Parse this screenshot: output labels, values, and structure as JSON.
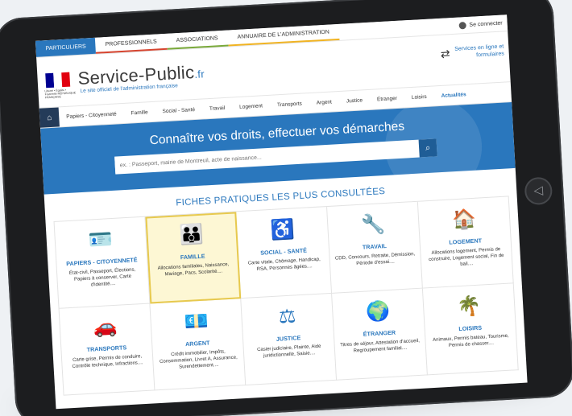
{
  "topnav": {
    "tabs": [
      "Particuliers",
      "Professionnels",
      "Associations",
      "Annuaire de l'administration"
    ],
    "connect": "Se connecter"
  },
  "brand": {
    "name": "Service-Public",
    "suffix": ".fr",
    "tagline": "Le site officiel de l'administration française",
    "logo_text": "Liberté • Égalité • Fraternité RÉPUBLIQUE FRANÇAISE",
    "services": "Services en ligne et formulaires"
  },
  "colors": {
    "flag_blue": "#000091",
    "flag_white": "#ffffff",
    "flag_red": "#e1000f",
    "accent": "#2a77bd"
  },
  "categories": [
    "Papiers - Citoyenneté",
    "Famille",
    "Social - Santé",
    "Travail",
    "Logement",
    "Transports",
    "Argent",
    "Justice",
    "Étranger",
    "Loisirs",
    "Actualités"
  ],
  "hero": {
    "title": "Connaître vos droits, effectuer vos démarches",
    "placeholder": "ex. : Passeport, mairie de Montreuil, acte de naissance..."
  },
  "section_title": "FICHES PRATIQUES LES PLUS CONSULTÉES",
  "cards": [
    {
      "title": "Papiers - Citoyenneté",
      "desc": "État-civil, Passeport, Élections, Papiers à conserver, Carte d'identité....",
      "icon": "id-card-icon"
    },
    {
      "title": "Famille",
      "desc": "Allocations familiales, Naissance, Mariage, Pacs, Scolarité....",
      "icon": "family-icon"
    },
    {
      "title": "Social - Santé",
      "desc": "Carte vitale, Chômage, Handicap, RSA, Personnes âgées....",
      "icon": "people-wheelchair-icon"
    },
    {
      "title": "Travail",
      "desc": "CDD, Concours, Retraite, Démission, Période d'essai....",
      "icon": "tools-icon"
    },
    {
      "title": "Logement",
      "desc": "Allocations logement, Permis de construire, Logement social, Fin de bail....",
      "icon": "house-icon"
    },
    {
      "title": "Transports",
      "desc": "Carte grise, Permis de conduire, Contrôle technique, Infractions....",
      "icon": "car-icon"
    },
    {
      "title": "Argent",
      "desc": "Crédit immobilier, Impôts, Consommation, Livret A, Assurance, Surendettement....",
      "icon": "money-icon"
    },
    {
      "title": "Justice",
      "desc": "Casier judiciaire, Plainte, Aide juridictionnelle, Saisie....",
      "icon": "scales-icon"
    },
    {
      "title": "Étranger",
      "desc": "Titres de séjour, Attestation d'accueil, Regroupement familial....",
      "icon": "globe-icon"
    },
    {
      "title": "Loisirs",
      "desc": "Animaux, Permis bateau, Tourisme, Permis de chasser....",
      "icon": "palm-tree-icon"
    }
  ]
}
